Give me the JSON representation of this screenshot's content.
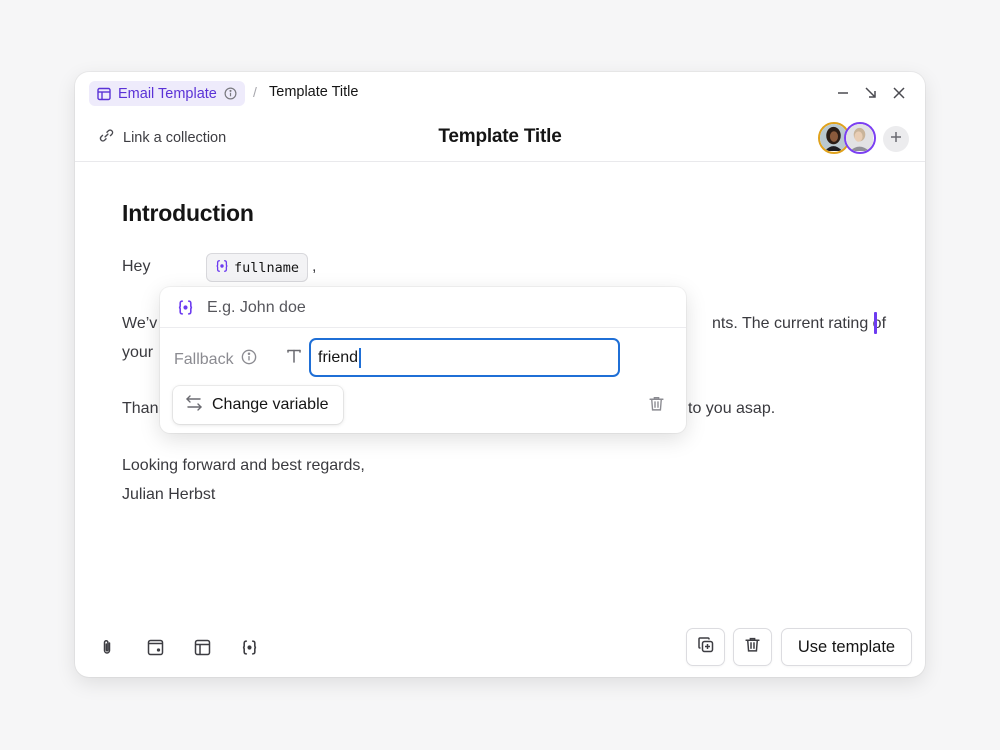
{
  "breadcrumb": {
    "chip_label": "Email Template",
    "separator": "/",
    "current": "Template Title"
  },
  "header": {
    "link_label": "Link a collection",
    "title": "Template Title"
  },
  "document": {
    "heading": "Introduction",
    "greeting_prefix": "Hey",
    "greeting_suffix": ",",
    "variable_name": "fullname",
    "para1_start": "We’v",
    "para1_end": "nts. The current rating of",
    "para1_line2": "your",
    "para2_start": "Than",
    "para2_end": "to you asap.",
    "closing": "Looking forward and best regards,",
    "signature": "Julian Herbst"
  },
  "popover": {
    "placeholder": "E.g. John doe",
    "fallback_label": "Fallback",
    "fallback_value": "friend",
    "change_label": "Change variable"
  },
  "footer": {
    "use_label": "Use template"
  },
  "colors": {
    "accent_purple": "#6d3cf0",
    "focus_blue": "#1f6fd6",
    "avatar1_ring": "#e0a21c",
    "avatar2_ring": "#7b3ff2"
  }
}
